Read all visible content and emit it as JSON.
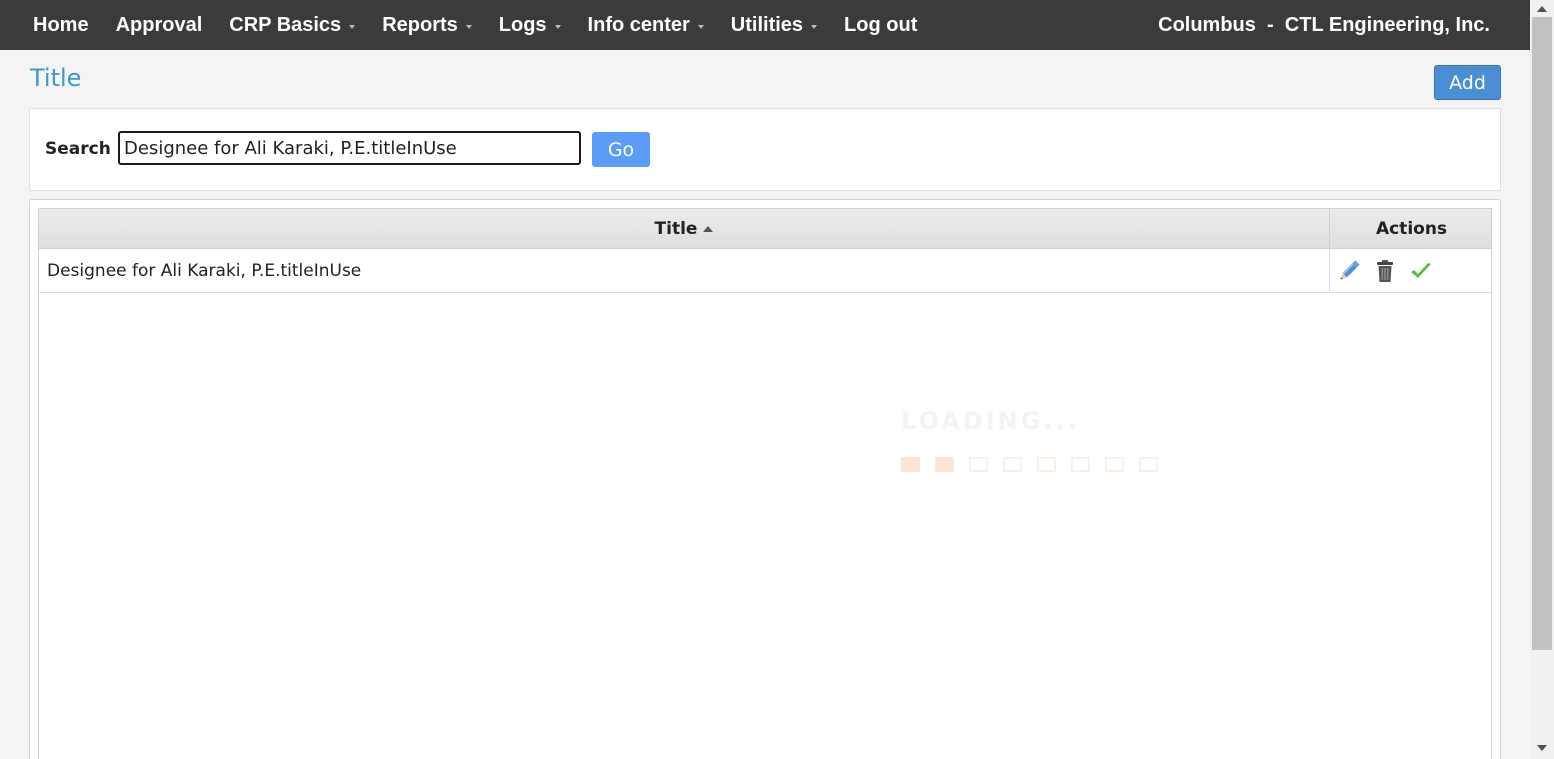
{
  "nav": {
    "items": [
      {
        "label": "Home",
        "dropdown": false
      },
      {
        "label": "Approval",
        "dropdown": false
      },
      {
        "label": "CRP Basics",
        "dropdown": true
      },
      {
        "label": "Reports",
        "dropdown": true
      },
      {
        "label": "Logs",
        "dropdown": true
      },
      {
        "label": "Info center",
        "dropdown": true
      },
      {
        "label": "Utilities",
        "dropdown": true
      },
      {
        "label": "Log out",
        "dropdown": false
      }
    ],
    "company": "Columbus  -  CTL Engineering, Inc."
  },
  "page": {
    "title": "Title",
    "add_label": "Add"
  },
  "search": {
    "label": "Search",
    "value": "Designee for Ali Karaki, P.E.titleInUse",
    "go_label": "Go"
  },
  "grid": {
    "columns": {
      "title": "Title",
      "actions": "Actions"
    },
    "sort": "ascending",
    "rows": [
      {
        "title": "Designee for Ali Karaki, P.E.titleInUse",
        "actions": [
          "edit-icon",
          "delete-icon",
          "check-icon"
        ]
      }
    ]
  },
  "loading": {
    "text": "LOADING...",
    "blocks_total": 8,
    "blocks_filled": 2
  },
  "colors": {
    "navbar": "#3b3b3b",
    "accent": "#3a9ad0",
    "add_button": "#4a8fd3",
    "go_button": "#5a9cf8"
  }
}
